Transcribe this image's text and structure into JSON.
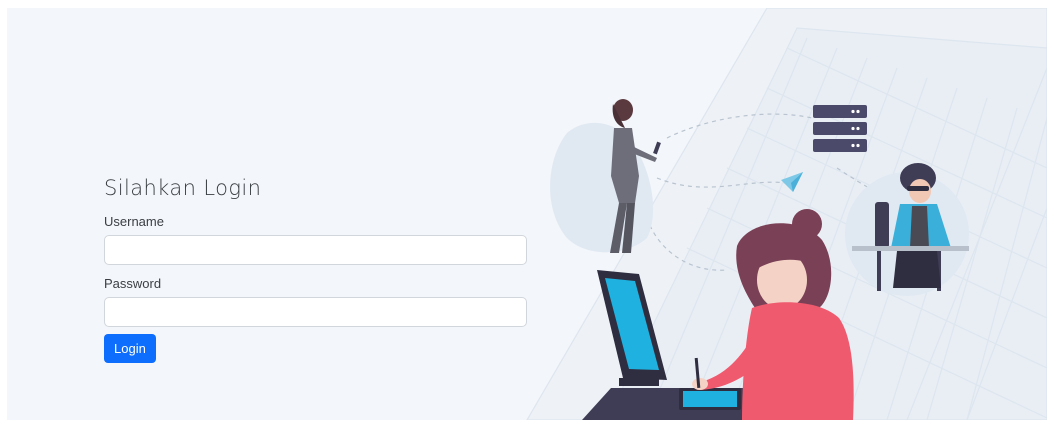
{
  "login": {
    "title": "Silahkan Login",
    "username_label": "Username",
    "username_value": "",
    "password_label": "Password",
    "password_value": "",
    "submit_label": "Login"
  },
  "colors": {
    "page_bg": "#f3f6fa",
    "button": "#0d6efd",
    "accent_cyan": "#1fb2e0",
    "shirt_pink": "#ef5a6f",
    "hair": "#7a4055",
    "dark_navy": "#3f3d56"
  },
  "illustration": {
    "description_icons": [
      "building-background",
      "woman-with-phone",
      "server-stack-icon",
      "paper-plane-icon",
      "man-with-sunglasses-at-desk",
      "woman-at-computer"
    ]
  }
}
